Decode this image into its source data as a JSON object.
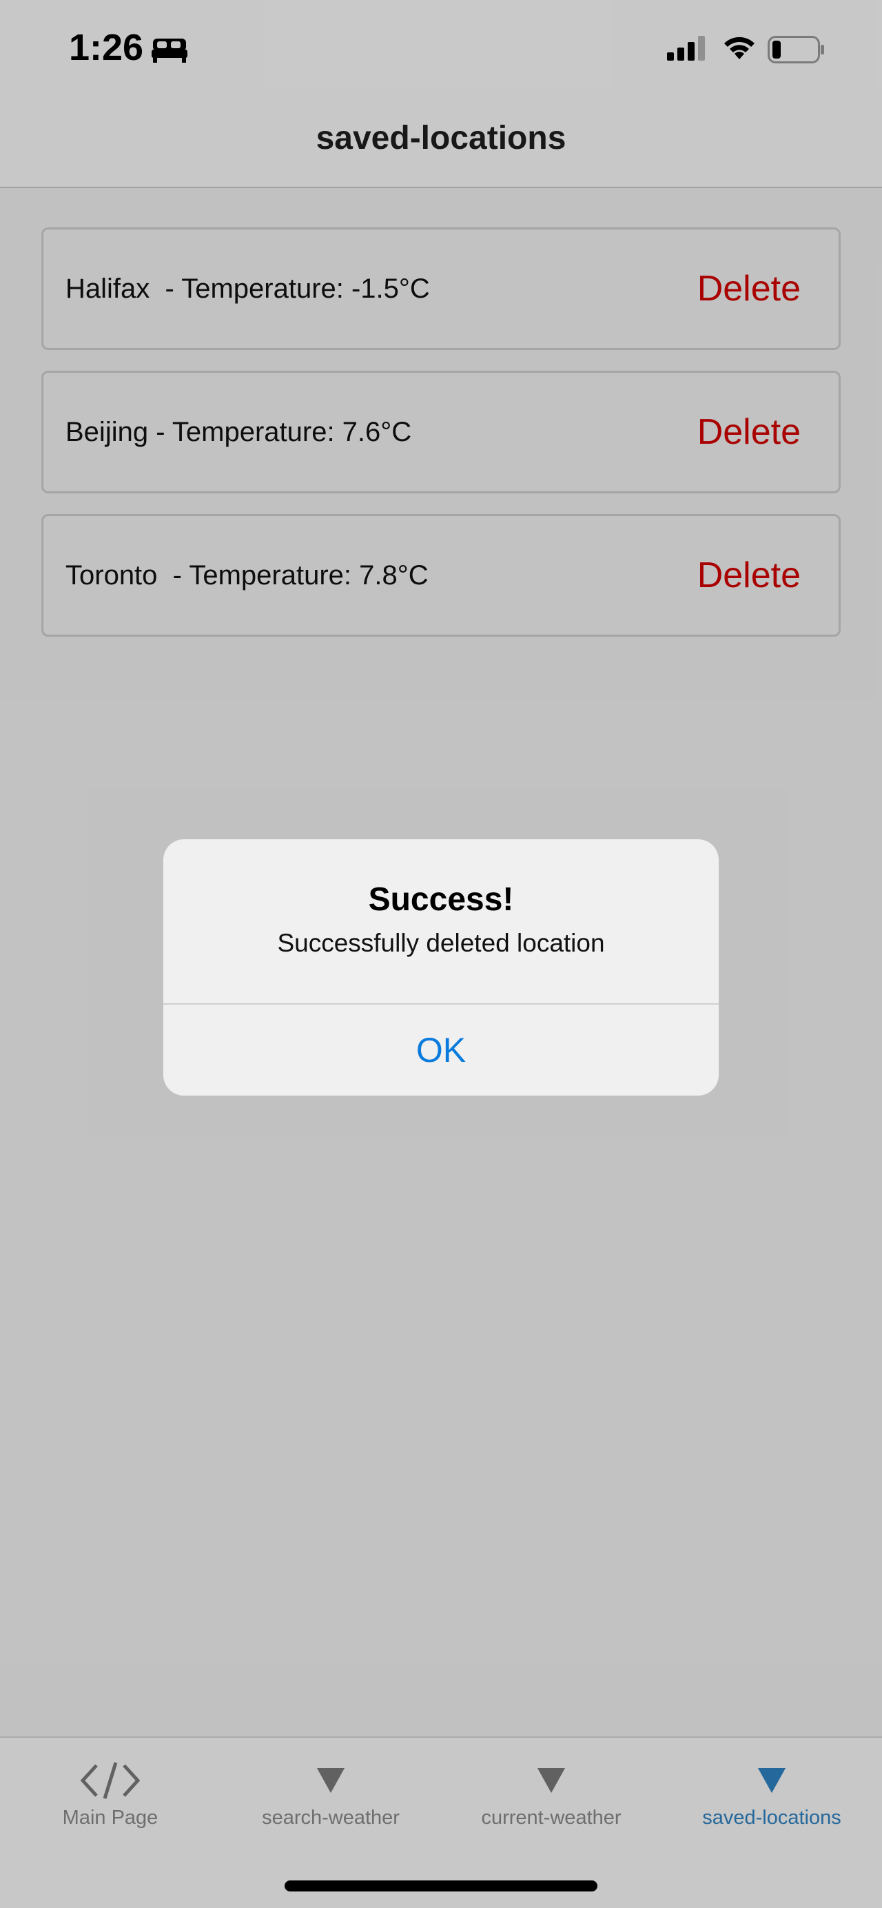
{
  "status_bar": {
    "time": "1:26"
  },
  "header": {
    "title": "saved-locations"
  },
  "locations": [
    {
      "text": "Halifax  - Temperature: -1.5°C",
      "delete_label": "Delete"
    },
    {
      "text": "Beijing - Temperature: 7.6°C",
      "delete_label": "Delete"
    },
    {
      "text": "Toronto  - Temperature: 7.8°C",
      "delete_label": "Delete"
    }
  ],
  "alert": {
    "title": "Success!",
    "message": "Successfully deleted location",
    "ok_label": "OK"
  },
  "tabs": [
    {
      "label": "Main Page",
      "icon": "code-icon",
      "active": false
    },
    {
      "label": "search-weather",
      "icon": "triangle-down-icon",
      "active": false
    },
    {
      "label": "current-weather",
      "icon": "triangle-down-icon",
      "active": false
    },
    {
      "label": "saved-locations",
      "icon": "triangle-down-icon",
      "active": true
    }
  ],
  "colors": {
    "delete": "#d40000",
    "accent": "#0a7bdc",
    "tab_active": "#2f83c2",
    "tab_inactive": "#8a8a8a"
  }
}
